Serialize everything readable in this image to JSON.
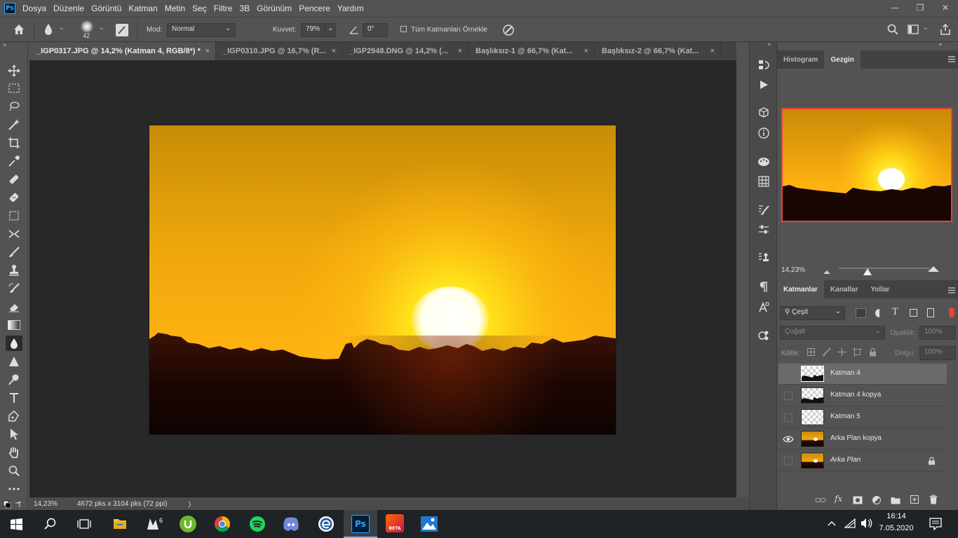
{
  "menubar": {
    "logo": "Ps",
    "items": [
      "Dosya",
      "Düzenle",
      "Görüntü",
      "Katman",
      "Metin",
      "Seç",
      "Filtre",
      "3B",
      "Görünüm",
      "Pencere",
      "Yardım"
    ]
  },
  "window_controls": {
    "minimize": "—",
    "restore": "❐",
    "close": "✕"
  },
  "options": {
    "brush_size": "42",
    "mode_label": "Mod:",
    "mode_value": "Normal",
    "strength_label": "Kuvvet:",
    "strength_value": "79%",
    "angle_value": "0°",
    "sample_all_label": "Tüm Katmanları Örnekle"
  },
  "tabs": [
    {
      "label": "_IGP0317.JPG @ 14,2% (Katman 4, RGB/8*) *",
      "active": true
    },
    {
      "label": "_IGP0310.JPG @ 16,7% (R...",
      "active": false
    },
    {
      "label": "_IGP2948.DNG @ 14,2% (...",
      "active": false
    },
    {
      "label": "Başlıksız-1 @ 66,7% (Kat...",
      "active": false
    },
    {
      "label": "Başlıksız-2 @ 66,7% (Kat...",
      "active": false
    }
  ],
  "tab_close": "×",
  "status": {
    "zoom": "14,23%",
    "doc_info": "4672 pks x 3104 pks (72 ppi)",
    "arrow": "〉"
  },
  "navigator": {
    "tabs": [
      "Histogram",
      "Gezgin"
    ],
    "zoom": "14,23%"
  },
  "layers_panel": {
    "tabs": [
      "Katmanlar",
      "Kanallar",
      "Yollar"
    ],
    "filter_label": "Çeşit",
    "blend_mode": "Çoğalt",
    "opacity_label": "Opaklık:",
    "opacity_value": "100%",
    "lock_label": "Kilitle:",
    "fill_label": "Dolgu:",
    "fill_value": "100%",
    "layers": [
      {
        "name": "Katman 4",
        "selected": true,
        "visible": false,
        "thumb": "checker-silhouette"
      },
      {
        "name": "Katman 4 kopya",
        "selected": false,
        "visible": false,
        "thumb": "checker-silhouette"
      },
      {
        "name": "Katman 5",
        "selected": false,
        "visible": false,
        "thumb": "checker"
      },
      {
        "name": "Arka Plan kopya",
        "selected": false,
        "visible": true,
        "thumb": "sunset"
      },
      {
        "name": "Arka Plan",
        "selected": false,
        "visible": false,
        "thumb": "sunset",
        "locked": true
      }
    ]
  },
  "taskbar": {
    "time": "16:14",
    "date": "7.05.2020",
    "apps": [
      "start",
      "search",
      "task-view",
      "file-explorer",
      "app-6",
      "utorrent",
      "chrome",
      "spotify",
      "discord",
      "edge-like",
      "photoshop",
      "app-beta",
      "photos"
    ],
    "beta_label": "BETA",
    "ps_label": "Ps"
  },
  "colors": {
    "accent_red": "#e8423b",
    "ps_blue": "#31a8ff",
    "panel_bg": "#535353",
    "canvas_bg": "#282828"
  }
}
